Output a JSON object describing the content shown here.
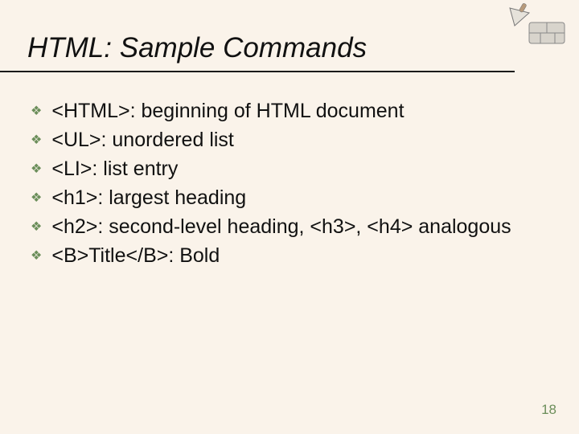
{
  "title": "HTML: Sample Commands",
  "items": [
    "<HTML>: beginning of HTML document",
    "<UL>: unordered list",
    "<LI>: list entry",
    "<h1>: largest heading",
    "<h2>: second-level heading, <h3>, <h4> analogous",
    "<B>Title</B>: Bold"
  ],
  "page_number": "18"
}
